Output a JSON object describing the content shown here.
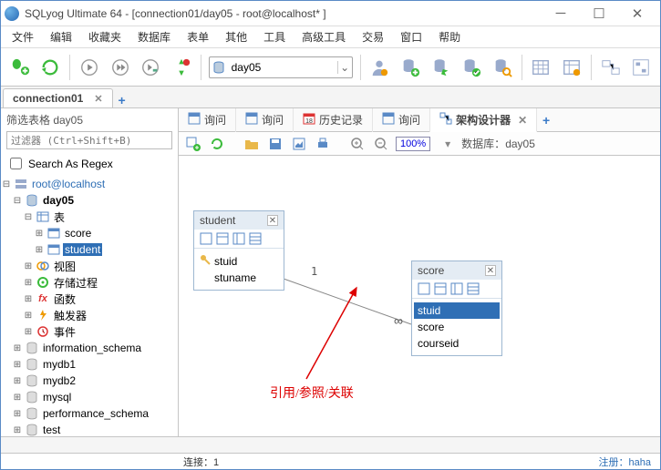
{
  "window": {
    "title": "SQLyog Ultimate 64 - [connection01/day05 - root@localhost* ]"
  },
  "menu": {
    "items": [
      "文件",
      "编辑",
      "收藏夹",
      "数据库",
      "表单",
      "其他",
      "工具",
      "高级工具",
      "交易",
      "窗口",
      "帮助"
    ]
  },
  "toolbar": {
    "db_selected": "day05"
  },
  "conn_tabs": {
    "active": "connection01"
  },
  "side": {
    "filter_label": "筛选表格 day05",
    "filter_placeholder": "过滤器 (Ctrl+Shift+B)",
    "regex_label": "Search As Regex",
    "tree": {
      "root": "root@localhost",
      "db": "day05",
      "tables_label": "表",
      "tables": [
        "score",
        "student"
      ],
      "views": "视图",
      "procs": "存储过程",
      "funcs": "函数",
      "triggers": "触发器",
      "events": "事件",
      "other_dbs": [
        "information_schema",
        "mydb1",
        "mydb2",
        "mysql",
        "performance_schema",
        "test"
      ]
    }
  },
  "content_tabs": {
    "t1": "询问",
    "t2": "询问",
    "t3": "历史记录",
    "t4": "询问",
    "t5": "架构设计器"
  },
  "schema_toolbar": {
    "zoom": "100%",
    "db_label": "数据库：",
    "db_value": "day05"
  },
  "canvas": {
    "tbl1": {
      "name": "student",
      "cols": [
        "stuid",
        "stuname"
      ],
      "key_col_index": 0
    },
    "tbl2": {
      "name": "score",
      "cols": [
        "stuid",
        "score",
        "courseid"
      ],
      "sel_index": 0
    },
    "link_label_1": "1",
    "link_label_inf": "∞",
    "annotation": "引用/参照/关联"
  },
  "status": {
    "conn": "连接：1",
    "reg_label": "注册：",
    "reg_value": "haha"
  }
}
